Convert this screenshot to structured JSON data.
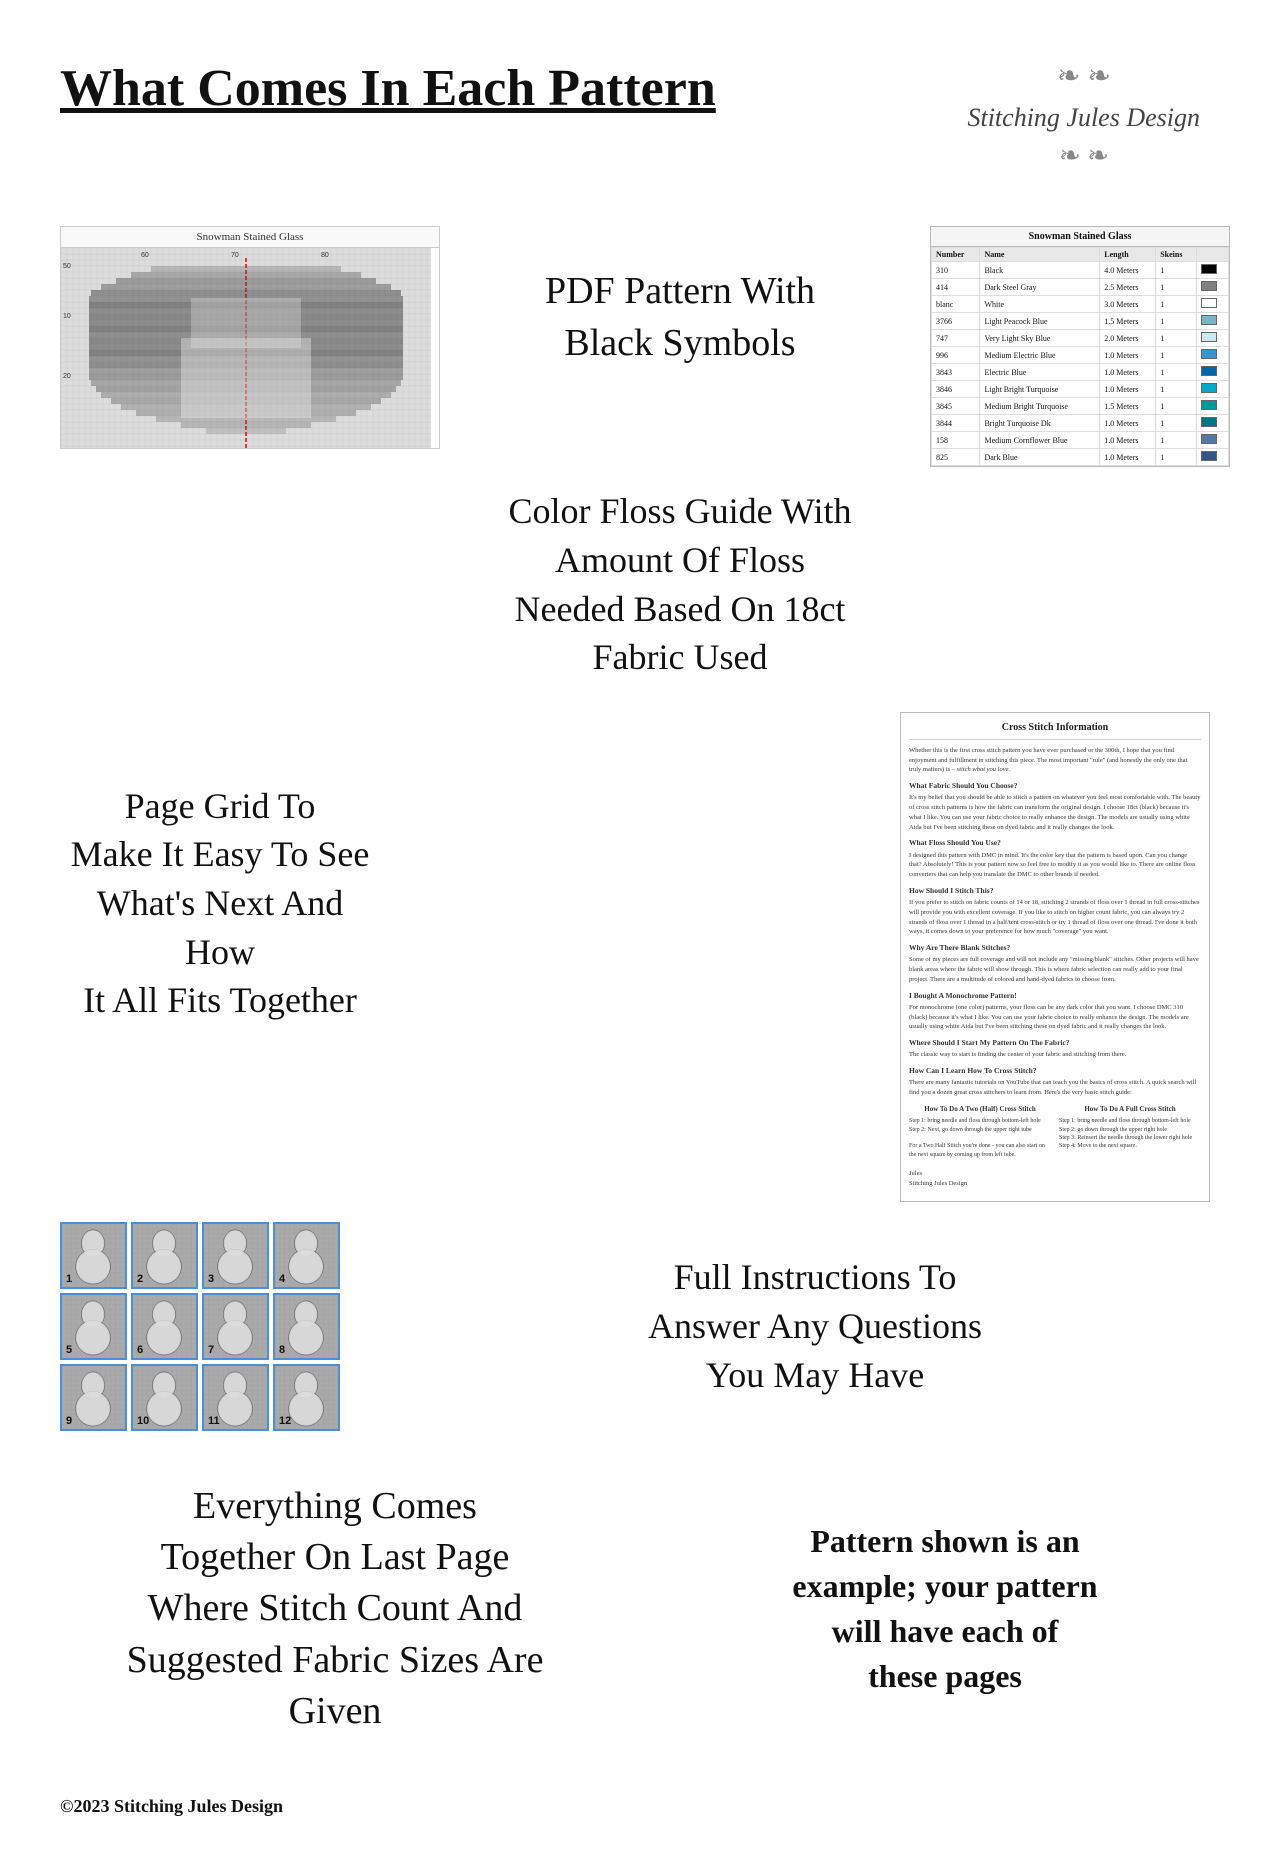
{
  "header": {
    "title": "What Comes In Each Pattern",
    "brand": {
      "name": "Stitching Jules Design",
      "ornament": "🌿"
    }
  },
  "sections": {
    "pdf_pattern": "PDF Pattern With\nBlack Symbols",
    "color_floss": "Color Floss Guide With\nAmount Of Floss\nNeeded Based On 18ct\nFabric Used",
    "page_grid": "Page Grid To\nMake It Easy To See\nWhat's Next And How\nIt All Fits Together",
    "full_instructions": "Full Instructions To\nAnswer Any Questions\nYou May Have",
    "everything_together": "Everything Comes\nTogether On Last Page\nWhere Stitch Count And\nSuggested Fabric Sizes Are\nGiven",
    "example_note": "Pattern shown is an example; your pattern will have each of these pages"
  },
  "pattern_title": "Snowman Stained Glass",
  "page_thumbnails": [
    "1",
    "2",
    "3",
    "4",
    "5",
    "6",
    "7",
    "8",
    "9",
    "10",
    "11",
    "12"
  ],
  "floss_table": {
    "headers": [
      "Number",
      "Name",
      "Length",
      "Skeins"
    ],
    "rows": [
      {
        "number": "310",
        "name": "Black",
        "length": "4.0 Meters",
        "skeins": "1",
        "color": "#000000"
      },
      {
        "number": "414",
        "name": "Dark Steel Gray",
        "length": "2.5 Meters",
        "skeins": "1",
        "color": "#808080"
      },
      {
        "number": "blanc",
        "name": "White",
        "length": "3.0 Meters",
        "skeins": "1",
        "color": "#ffffff"
      },
      {
        "number": "3766",
        "name": "Light Peacock Blue",
        "length": "1.5 Meters",
        "skeins": "1",
        "color": "#7ab5c5"
      },
      {
        "number": "747",
        "name": "Very Light Sky Blue",
        "length": "2.0 Meters",
        "skeins": "1",
        "color": "#cce8f0"
      },
      {
        "number": "996",
        "name": "Medium Electric Blue",
        "length": "1.0 Meters",
        "skeins": "1",
        "color": "#3399cc"
      },
      {
        "number": "3843",
        "name": "Electric Blue",
        "length": "1.0 Meters",
        "skeins": "1",
        "color": "#0066aa"
      },
      {
        "number": "3846",
        "name": "Light Bright Turquoise",
        "length": "1.0 Meters",
        "skeins": "1",
        "color": "#00aacc"
      },
      {
        "number": "3845",
        "name": "Medium Bright Turquoise",
        "length": "1.5 Meters",
        "skeins": "1",
        "color": "#009999"
      },
      {
        "number": "3844",
        "name": "Bright Turquoise Dk",
        "length": "1.0 Meters",
        "skeins": "1",
        "color": "#007788"
      },
      {
        "number": "158",
        "name": "Medium Cornflower Blue",
        "length": "1.0 Meters",
        "skeins": "1",
        "color": "#5577aa"
      },
      {
        "number": "825",
        "name": "Dark Blue",
        "length": "1.0 Meters",
        "skeins": "1",
        "color": "#335588"
      }
    ]
  },
  "instructions": {
    "title": "Cross Stitch Information",
    "paragraphs": [
      "Whether this is the first cross stitch pattern you have ever purchased or the 300th, I hope that you find enjoyment and fulfillment in stitching this piece. The most important \"rule\" (and honestly the only one that truly matters) is – stitch what you love.",
      "What Fabric Should You Choose? It's my belief that you should be able to stitch a pattern on whatever you feel most comfortable with. The beauty of cross stitch patterns is how the fabric can transform the original design. I choose 18ct (black) because it's what I like. You can use your fabric choice to really enhance the design.",
      "What Floss Should You Use? I designed this pattern with DMC in mind. It's the color key that the pattern is based upon. Can you change that? Absolutely! This is your pattern now so feel free to modify it as you would like to. There are online floss converters that can help you translate the DMC to other brands if needed.",
      "How Should I Stitch This? If you prefer to stitch on fabric counts of 14 or 18, stitching 2 strands of floss over 1 thread in full cross-stitches will provide you with excellent coverage.",
      "Why Are There Blank Stitches? Some of my pieces are full coverage and will not include any 'missing/blank' stitches. Other projects will have blank areas where the fabric will show through. This is where fabric selection can really add to your final project. There are a multitude of colored and hand-dyed fabrics to choose from.",
      "I Bought A Monochrome Pattern! For monochrome (one color) patterns, your floss can be any dark color that you want. I choose DMC 310 (black) because it's what I like. You can use your fabric choice to really enhance the design. The models are usually using white Aida but I've been stitching these on dyed fabric and it really changes the look.",
      "Where Should I Start My Pattern On The Fabric? The classic way to start is finding the center of your fabric and stitching from there.",
      "How Can I Learn How To Cross Stitch? There are many fantastic tutorials on YouTube that can teach you the basics of cross stitch. A quick search will find you a dozen great cross stitchers to learn from. Here's the very basic stitch guide:"
    ],
    "stitch_steps_left_title": "How To Do A Two (Half) Cross Stitch",
    "stitch_steps_right_title": "How To Do A Full Cross Stitch",
    "steps_left": "Step 1: bring needle and floss through bottom-left hole\nStep 2: Next, go down through the upper right hole\nFor a Two Half Stitch you're done - you can also start on the next square by coming up from left hole",
    "steps_right": "Step 1: bring needle and floss through bottom-left hole\nStep 2: go down through the upper right hole\nStep 3: Reinsert the needle through the lower right hole\nStep 4: Move to the next square",
    "signature": "Jules\nStitching Jules Design"
  },
  "footer": {
    "copyright": "©2023 Stitching Jules Design"
  }
}
